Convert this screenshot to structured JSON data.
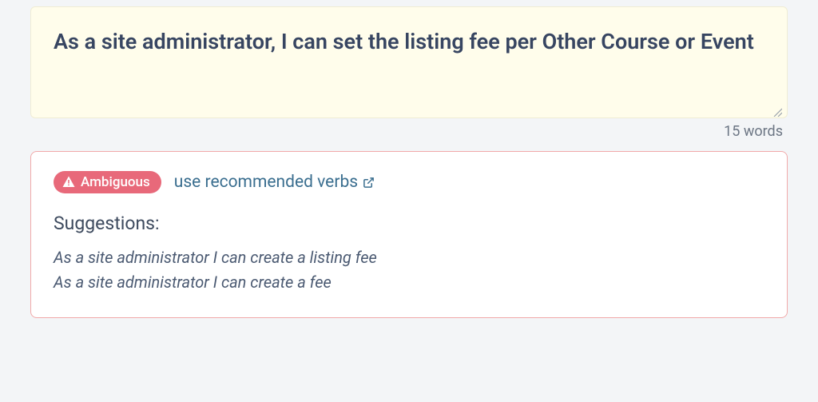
{
  "input": {
    "text": "As a site administrator, I can set the listing fee per Other Course or Event",
    "word_count": "15 words"
  },
  "feedback": {
    "badge_label": "Ambiguous",
    "link_text": "use recommended verbs",
    "suggestions_title": "Suggestions:",
    "suggestions": [
      "As a site administrator I can create a listing fee",
      "As a site administrator I can create a fee"
    ]
  }
}
